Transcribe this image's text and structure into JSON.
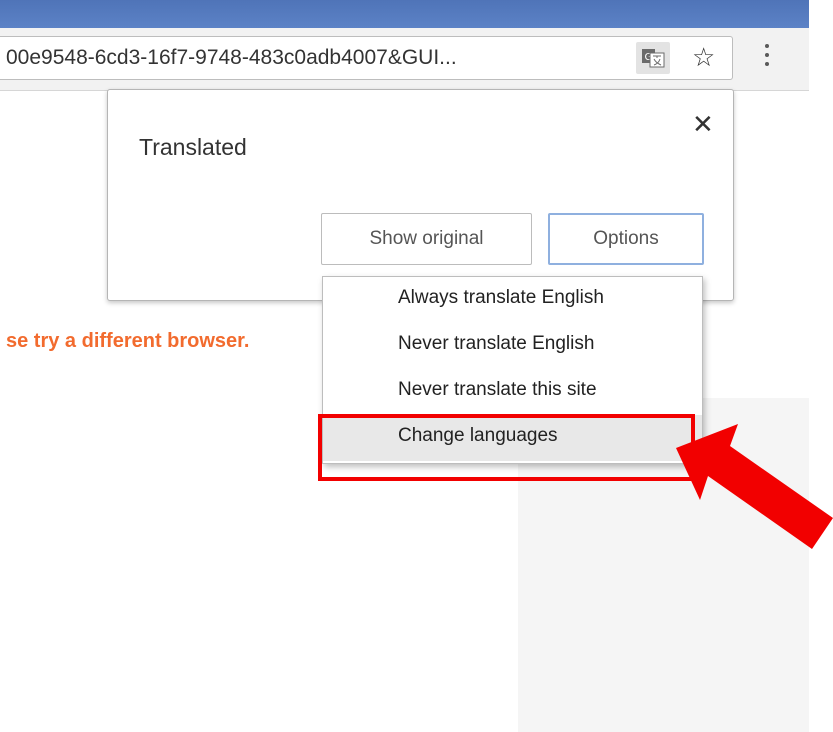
{
  "browser": {
    "url": "00e9548-6cd3-16f7-9748-483c0adb4007&GUI...",
    "translate_icon": "translate-icon",
    "star_icon": "star-icon",
    "menu_icon": "kebab-menu-icon"
  },
  "translate_bubble": {
    "title": "Translated",
    "close_icon": "close-icon",
    "show_original_label": "Show original",
    "options_label": "Options"
  },
  "options_menu": {
    "items": [
      {
        "label": "Always translate English"
      },
      {
        "label": "Never translate English"
      },
      {
        "label": "Never translate this site"
      },
      {
        "label": "Change languages"
      }
    ],
    "highlighted_item": "Change languages"
  },
  "page": {
    "error_text": "se try a different browser."
  },
  "annotation": {
    "highlight_color": "#f20000",
    "arrow_color": "#f20000"
  },
  "glyphs": {
    "star": "☆",
    "close": "✕"
  }
}
